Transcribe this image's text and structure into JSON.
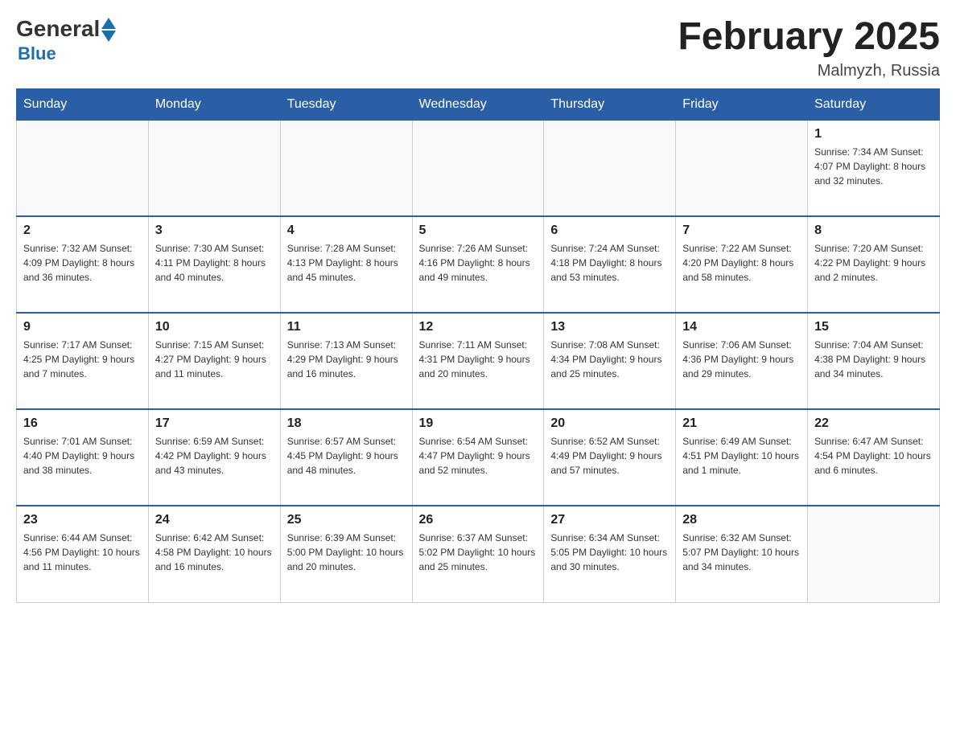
{
  "header": {
    "logo_general": "General",
    "logo_blue": "Blue",
    "month_title": "February 2025",
    "location": "Malmyzh, Russia"
  },
  "days_of_week": [
    "Sunday",
    "Monday",
    "Tuesday",
    "Wednesday",
    "Thursday",
    "Friday",
    "Saturday"
  ],
  "weeks": [
    [
      {
        "day": "",
        "info": ""
      },
      {
        "day": "",
        "info": ""
      },
      {
        "day": "",
        "info": ""
      },
      {
        "day": "",
        "info": ""
      },
      {
        "day": "",
        "info": ""
      },
      {
        "day": "",
        "info": ""
      },
      {
        "day": "1",
        "info": "Sunrise: 7:34 AM\nSunset: 4:07 PM\nDaylight: 8 hours and 32 minutes."
      }
    ],
    [
      {
        "day": "2",
        "info": "Sunrise: 7:32 AM\nSunset: 4:09 PM\nDaylight: 8 hours and 36 minutes."
      },
      {
        "day": "3",
        "info": "Sunrise: 7:30 AM\nSunset: 4:11 PM\nDaylight: 8 hours and 40 minutes."
      },
      {
        "day": "4",
        "info": "Sunrise: 7:28 AM\nSunset: 4:13 PM\nDaylight: 8 hours and 45 minutes."
      },
      {
        "day": "5",
        "info": "Sunrise: 7:26 AM\nSunset: 4:16 PM\nDaylight: 8 hours and 49 minutes."
      },
      {
        "day": "6",
        "info": "Sunrise: 7:24 AM\nSunset: 4:18 PM\nDaylight: 8 hours and 53 minutes."
      },
      {
        "day": "7",
        "info": "Sunrise: 7:22 AM\nSunset: 4:20 PM\nDaylight: 8 hours and 58 minutes."
      },
      {
        "day": "8",
        "info": "Sunrise: 7:20 AM\nSunset: 4:22 PM\nDaylight: 9 hours and 2 minutes."
      }
    ],
    [
      {
        "day": "9",
        "info": "Sunrise: 7:17 AM\nSunset: 4:25 PM\nDaylight: 9 hours and 7 minutes."
      },
      {
        "day": "10",
        "info": "Sunrise: 7:15 AM\nSunset: 4:27 PM\nDaylight: 9 hours and 11 minutes."
      },
      {
        "day": "11",
        "info": "Sunrise: 7:13 AM\nSunset: 4:29 PM\nDaylight: 9 hours and 16 minutes."
      },
      {
        "day": "12",
        "info": "Sunrise: 7:11 AM\nSunset: 4:31 PM\nDaylight: 9 hours and 20 minutes."
      },
      {
        "day": "13",
        "info": "Sunrise: 7:08 AM\nSunset: 4:34 PM\nDaylight: 9 hours and 25 minutes."
      },
      {
        "day": "14",
        "info": "Sunrise: 7:06 AM\nSunset: 4:36 PM\nDaylight: 9 hours and 29 minutes."
      },
      {
        "day": "15",
        "info": "Sunrise: 7:04 AM\nSunset: 4:38 PM\nDaylight: 9 hours and 34 minutes."
      }
    ],
    [
      {
        "day": "16",
        "info": "Sunrise: 7:01 AM\nSunset: 4:40 PM\nDaylight: 9 hours and 38 minutes."
      },
      {
        "day": "17",
        "info": "Sunrise: 6:59 AM\nSunset: 4:42 PM\nDaylight: 9 hours and 43 minutes."
      },
      {
        "day": "18",
        "info": "Sunrise: 6:57 AM\nSunset: 4:45 PM\nDaylight: 9 hours and 48 minutes."
      },
      {
        "day": "19",
        "info": "Sunrise: 6:54 AM\nSunset: 4:47 PM\nDaylight: 9 hours and 52 minutes."
      },
      {
        "day": "20",
        "info": "Sunrise: 6:52 AM\nSunset: 4:49 PM\nDaylight: 9 hours and 57 minutes."
      },
      {
        "day": "21",
        "info": "Sunrise: 6:49 AM\nSunset: 4:51 PM\nDaylight: 10 hours and 1 minute."
      },
      {
        "day": "22",
        "info": "Sunrise: 6:47 AM\nSunset: 4:54 PM\nDaylight: 10 hours and 6 minutes."
      }
    ],
    [
      {
        "day": "23",
        "info": "Sunrise: 6:44 AM\nSunset: 4:56 PM\nDaylight: 10 hours and 11 minutes."
      },
      {
        "day": "24",
        "info": "Sunrise: 6:42 AM\nSunset: 4:58 PM\nDaylight: 10 hours and 16 minutes."
      },
      {
        "day": "25",
        "info": "Sunrise: 6:39 AM\nSunset: 5:00 PM\nDaylight: 10 hours and 20 minutes."
      },
      {
        "day": "26",
        "info": "Sunrise: 6:37 AM\nSunset: 5:02 PM\nDaylight: 10 hours and 25 minutes."
      },
      {
        "day": "27",
        "info": "Sunrise: 6:34 AM\nSunset: 5:05 PM\nDaylight: 10 hours and 30 minutes."
      },
      {
        "day": "28",
        "info": "Sunrise: 6:32 AM\nSunset: 5:07 PM\nDaylight: 10 hours and 34 minutes."
      },
      {
        "day": "",
        "info": ""
      }
    ]
  ]
}
